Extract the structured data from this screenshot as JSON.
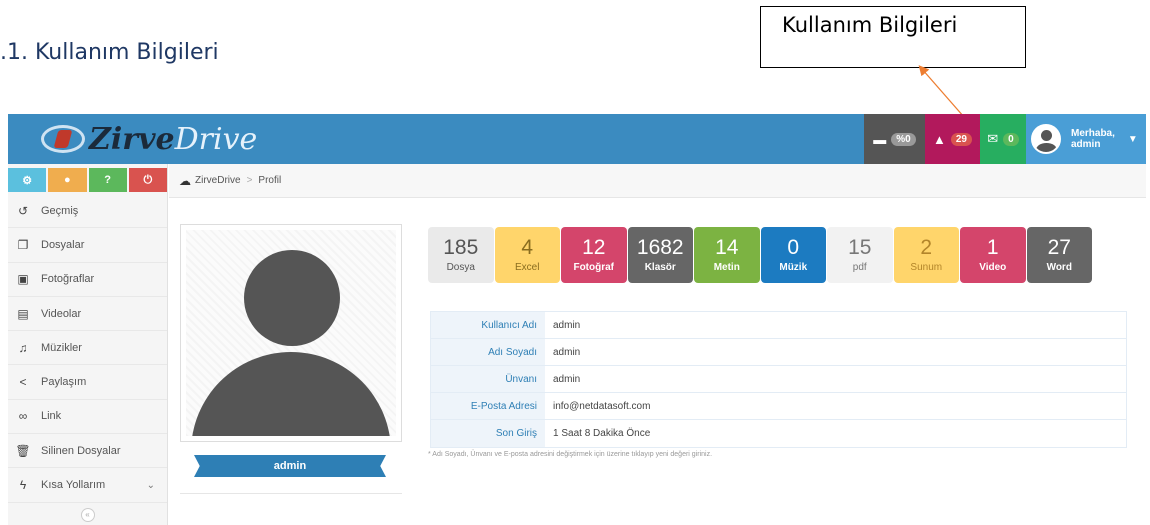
{
  "document": {
    "heading": ".1. Kullanım Bilgileri",
    "callout": "Kullanım Bilgileri"
  },
  "app": {
    "logo": {
      "part1": "Zirve",
      "part2": "Drive"
    },
    "topbar": {
      "storage_badge": "%0",
      "notification_count": "29",
      "message_count": "0",
      "greeting_line1": "Merhaba,",
      "greeting_line2": "admin"
    },
    "sidebar": {
      "items": [
        {
          "label": "Geçmiş",
          "icon": "history-icon"
        },
        {
          "label": "Dosyalar",
          "icon": "files-icon"
        },
        {
          "label": "Fotoğraflar",
          "icon": "image-icon"
        },
        {
          "label": "Videolar",
          "icon": "film-icon"
        },
        {
          "label": "Müzikler",
          "icon": "music-icon"
        },
        {
          "label": "Paylaşım",
          "icon": "share-icon"
        },
        {
          "label": "Link",
          "icon": "link-icon"
        },
        {
          "label": "Silinen Dosyalar",
          "icon": "trash-icon"
        },
        {
          "label": "Kısa Yollarım",
          "icon": "bolt-icon"
        }
      ]
    },
    "breadcrumb": {
      "root": "ZirveDrive",
      "current": "Profil"
    },
    "profile": {
      "username": "admin"
    },
    "stats": [
      {
        "count": "185",
        "label": "Dosya"
      },
      {
        "count": "4",
        "label": "Excel"
      },
      {
        "count": "12",
        "label": "Fotoğraf"
      },
      {
        "count": "1682",
        "label": "Klasör"
      },
      {
        "count": "14",
        "label": "Metin"
      },
      {
        "count": "0",
        "label": "Müzik"
      },
      {
        "count": "15",
        "label": "pdf"
      },
      {
        "count": "2",
        "label": "Sunum"
      },
      {
        "count": "1",
        "label": "Video"
      },
      {
        "count": "27",
        "label": "Word"
      }
    ],
    "info": [
      {
        "label": "Kullanıcı Adı",
        "value": "admin"
      },
      {
        "label": "Adı Soyadı",
        "value": "admin"
      },
      {
        "label": "Ünvanı",
        "value": "admin"
      },
      {
        "label": "E-Posta Adresi",
        "value": "info@netdatasoft.com"
      },
      {
        "label": "Son Giriş",
        "value": "1 Saat 8 Dakika Önce"
      }
    ],
    "info_note": "* Adı Soyadı, Ünvanı ve E-posta adresini değiştirmek için üzerine tıklayıp yeni değeri giriniz."
  },
  "colors": {
    "topbar": "#3b8bc0",
    "accent": "#2e7fb5",
    "arrow": "#ed7d31"
  }
}
